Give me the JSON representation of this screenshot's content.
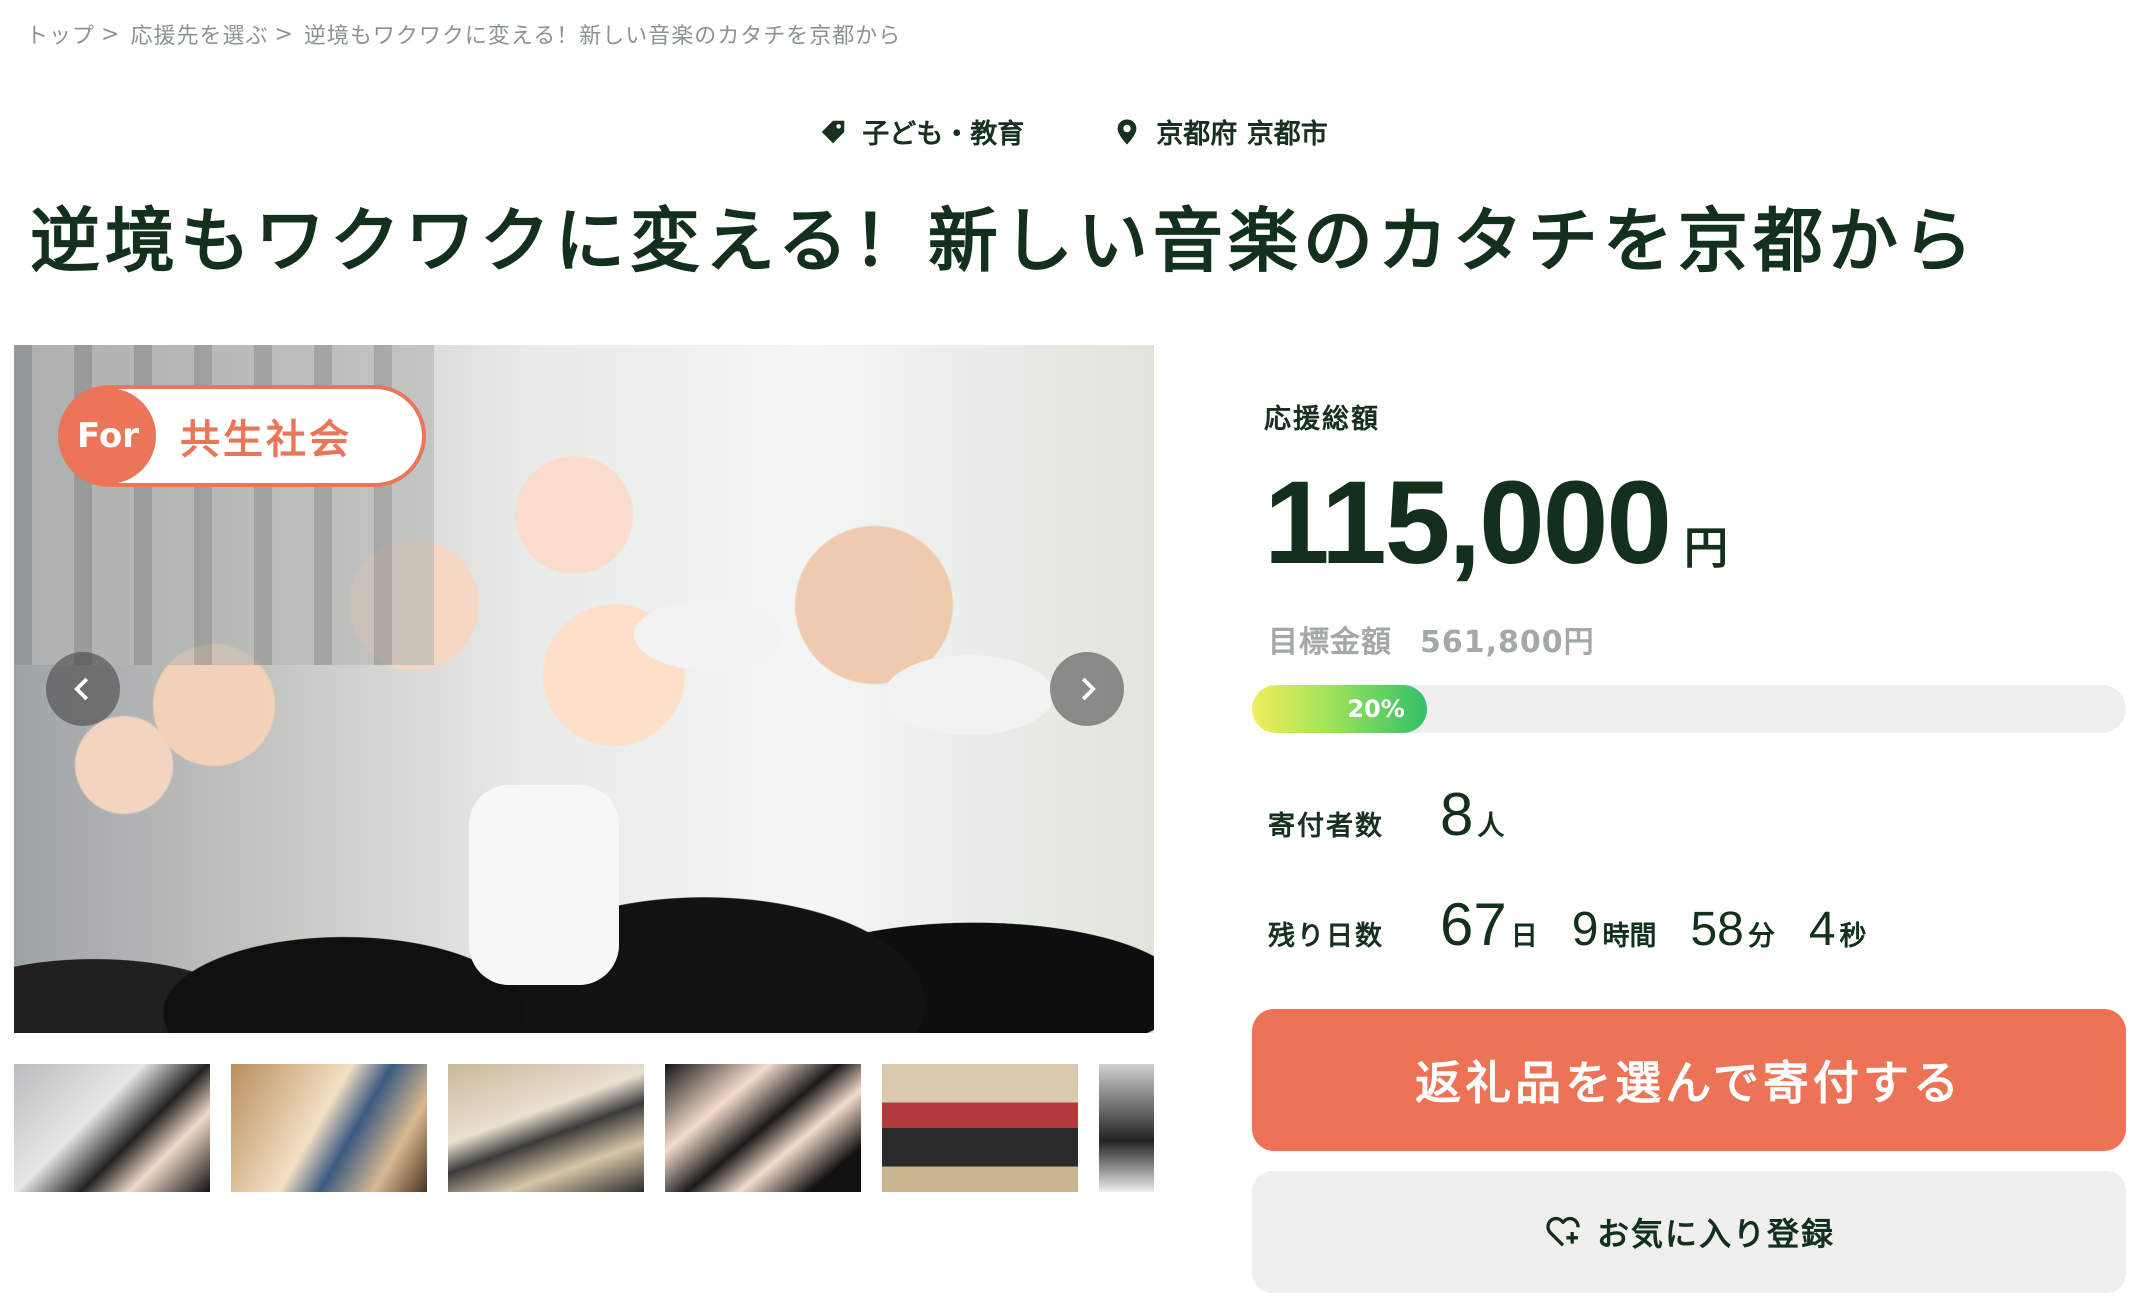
{
  "breadcrumb": {
    "items": [
      "トップ",
      "応援先を選ぶ",
      "逆境もワクワクに変える！新しい音楽のカタチを京都から"
    ],
    "separator": ">"
  },
  "meta": {
    "category": "子ども・教育",
    "category_icon": "tag-icon",
    "location": "京都府 京都市",
    "location_icon": "map-pin-icon"
  },
  "project": {
    "title": "逆境もワクワクに変える！新しい音楽のカタチを京都から"
  },
  "hero": {
    "badge_for": "For",
    "badge_topic": "共生社会",
    "thumbnail_count_visible": 6
  },
  "funding": {
    "total_label": "応援総額",
    "total_amount": "115,000",
    "currency_unit": "円",
    "target_label": "目標金額",
    "target_amount": "561,800円",
    "progress_percent": 20,
    "progress_text": "20%",
    "donors_label": "寄付者数",
    "donors_count": "8",
    "donors_unit": "人",
    "remaining_label": "残り日数",
    "remaining": {
      "days": "67",
      "days_unit": "日",
      "hours": "9",
      "hours_unit": "時間",
      "minutes": "58",
      "minutes_unit": "分",
      "seconds": "4",
      "seconds_unit": "秒"
    }
  },
  "actions": {
    "donate_label": "返礼品を選んで寄付する",
    "favorite_label": "お気に入り登録",
    "favorite_icon": "heart-plus-icon"
  },
  "colors": {
    "accent": "#ec7356",
    "text_dark": "#13301d",
    "muted": "#a3aaa4",
    "progress_start": "#f1ee5a",
    "progress_end": "#32c06a"
  }
}
